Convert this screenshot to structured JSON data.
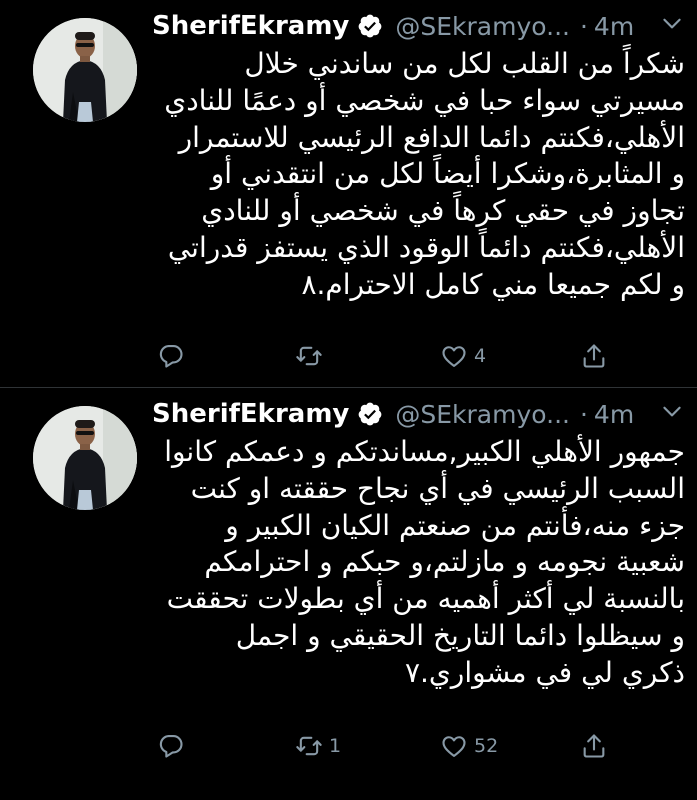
{
  "colors": {
    "background": "#000000",
    "text": "#ffffff",
    "secondary": "#8899a6",
    "divider": "#2f3336",
    "verified_badge": "#ffffff"
  },
  "tweets": [
    {
      "display_name": "SherifEkramy",
      "handle": "@SEkramyo...",
      "dot": "·",
      "time": "4m",
      "lines": [
        "شكراً من القلب لكل من ساندني خلال",
        "مسيرتي سواء حبا في شخصي أو دعمًا للنادي",
        "الأهلي،فكنتم دائما الدافع الرئيسي للاستمرار",
        "و المثابرة،وشكرا أيضاً لكل من انتقدني أو",
        "تجاوز في حقي كرهاً في شخصي أو للنادي",
        "الأهلي،فكنتم دائماً الوقود الذي يستفز قدراتي",
        "و لكم جميعا مني كامل الاحترام.٨"
      ],
      "actions": {
        "reply_icon": "reply-icon",
        "retweet_icon": "retweet-icon",
        "retweet_count": "",
        "like_icon": "heart-icon",
        "like_count": "4",
        "share_icon": "share-icon"
      }
    },
    {
      "display_name": "SherifEkramy",
      "handle": "@SEkramyo...",
      "dot": "·",
      "time": "4m",
      "lines": [
        "جمهور الأهلي الكبير,مساندتكم و دعمكم كانوا",
        "السبب الرئيسي في أي نجاح حققته او كنت",
        "جزء منه،فأنتم من صنعتم الكيان الكبير و",
        "شعبية نجومه و مازلتم،و حبكم و احترامكم",
        "بالنسبة لي أكثر أهميه من أي بطولات تحققت",
        "و سيظلوا دائما التاريخ الحقيقي و اجمل",
        "ذكري لي في مشواري.٧"
      ],
      "actions": {
        "reply_icon": "reply-icon",
        "retweet_icon": "retweet-icon",
        "retweet_count": "1",
        "like_icon": "heart-icon",
        "like_count": "52",
        "share_icon": "share-icon"
      }
    }
  ]
}
